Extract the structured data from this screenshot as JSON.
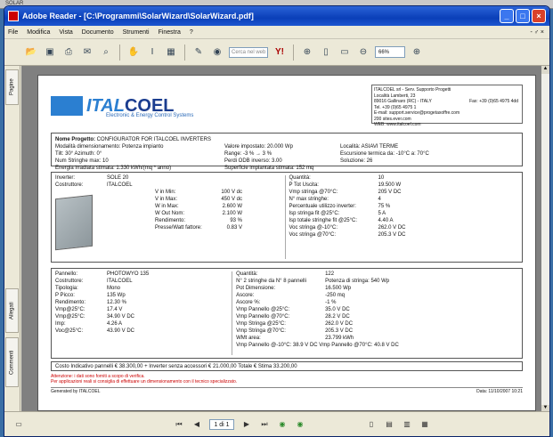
{
  "desktop": {
    "label": "SOLAR"
  },
  "window": {
    "title": "Adobe Reader - [C:\\Programmi\\SolarWizard\\SolarWizard.pdf]",
    "min": "_",
    "max": "□",
    "close": "×"
  },
  "menu": {
    "items": [
      "File",
      "Modifica",
      "Vista",
      "Documento",
      "Strumenti",
      "Finestra",
      "?"
    ],
    "right": "- ♂ ×"
  },
  "toolbar": {
    "search_placeholder": "Cerca nel web",
    "zoom": "66%"
  },
  "sidebar": {
    "tabs": [
      "Pagine",
      "Allegati",
      "Commenti"
    ]
  },
  "page": {
    "logo": {
      "name": "ITAL",
      "name2": "COEL",
      "sub": "Electronic & Energy Control Systems"
    },
    "address": {
      "l1": "ITALCOEL srl - Serv. Supporto Progetti",
      "l2": "Località Lamberti, 23",
      "l3": "89016 Gallinaro (RC) - ITALY",
      "l4": "Tel. +39 (0)65 4975 1",
      "fax": "Fax: +39 (0)65 4975 4dd",
      "l5": "E-mail: support.service@progetaxoffre.com",
      "l6": "200 sites.ever.com",
      "l7": "WEB: www.italcoel.com"
    },
    "project": {
      "name_label": "Nome Progetto:",
      "name": "CONFIGURATOR FOR ITALCOEL INVERTERS",
      "r1": "Modalità dimensionamento: Potenza impianto",
      "r1b": "Valore impostato: 20.000 Wp",
      "r1c": "Località: ASIAVI TERME",
      "r2": "Tilt: 30°   Azimuth: 0°",
      "r2b": "Range: -3 % → 3 %",
      "r2c": "Escursione termica da: -10°C a: 70°C",
      "r3": "Num Stringhe max: 10",
      "r3b": "Perdi ODB inverso: 3.00",
      "r3c": "Soluzione: 26",
      "r4": "Energia irradiata stimata: 1.330 kWh/(mq * anno)",
      "r4b": "Superficie impiantata stimata: 152 mq"
    },
    "inverter": {
      "kv": [
        [
          "Inverter:",
          "SOLE 20"
        ],
        [
          "Costruttore:",
          "ITALCOEL"
        ],
        [
          "V in Min:",
          "100 V dc"
        ],
        [
          "V in Max:",
          "450 V dc"
        ],
        [
          "W in Max:",
          "2.600 W"
        ],
        [
          "W Out Nom:",
          "2.100 W"
        ],
        [
          "Rendimento:",
          "93 %"
        ],
        [
          "Presse/Watt fattore:",
          "0.83 V"
        ]
      ],
      "kv2": [
        [
          "Quantità:",
          "10"
        ],
        [
          "P Tot Uscita:",
          "19.500 W"
        ],
        [
          "Vmp stringa @70°C:",
          "205 V DC"
        ],
        [
          "N° max stringhe:",
          "4"
        ],
        [
          "Percentuale utilizzo inverter:",
          "75 %"
        ],
        [
          "Isp stringa fit @25°C:",
          "5 A"
        ],
        [
          "Isp totale stringhe fit @25°C:",
          "4.40 A"
        ],
        [
          "Voc stringa @-10°C:",
          "262.0 V DC"
        ],
        [
          "Voc stringa @70°C:",
          "205.3 V DC"
        ]
      ]
    },
    "panel": {
      "kv": [
        [
          "Pannello:",
          "PHOTOWYO 135"
        ],
        [
          "Costruttore:",
          "ITALCOEL"
        ],
        [
          "Tipologia:",
          "Mono"
        ],
        [
          "P Picco:",
          "135 Wp"
        ],
        [
          "Rendimento:",
          "12.30 %"
        ],
        [
          "Vmp@25°C:",
          "17.4 V"
        ],
        [
          "Vmp@25°C:",
          "34.90 V DC"
        ],
        [
          "Imp:",
          "4.26 A"
        ],
        [
          "Voc@25°C:",
          "43.90 V DC"
        ]
      ],
      "kv2": [
        [
          "Quantità:",
          "122"
        ],
        [
          "N° 2 stringhe da N° 8 pannelli",
          "Potenza di stringa: 540 Wp"
        ],
        [
          "Pot Dimensione:",
          "16.500 Wp"
        ],
        [
          "Ascore:",
          "-250 mq"
        ],
        [
          "Ascore %:",
          "-1 %"
        ],
        [
          "Vmp Pannello @25°C:",
          "35.0 V DC"
        ],
        [
          "Vmp Pannello @70°C:",
          "28.2 V DC"
        ],
        [
          "Vmp Stringa @25°C:",
          "262.0 V DC"
        ],
        [
          "Vmp Stringa @70°C:",
          "205.3 V DC"
        ],
        [
          "WMt area:",
          "23.799 kWh"
        ]
      ],
      "extra": "Vmp Pannello @-10°C: 38.9 V DC   Vmp Pannello @70°C: 40.8 V DC"
    },
    "cost": "Costo Indicativo pannelli € 38.300,00 + Inverter senza accessori € 21.000,00  Totale € Stima 33.200,00",
    "note1": "Attenzione: i dati sono forniti a scopo di verifica.",
    "note2": "Per applicazioni reali si consiglia di effettuare un dimensionamento con il tecnico specializzato.",
    "footer_left": "Generated by ITALCOEL",
    "footer_right": "Data: 11/10/2007 10:21"
  },
  "status": {
    "page": "1 di 1"
  }
}
